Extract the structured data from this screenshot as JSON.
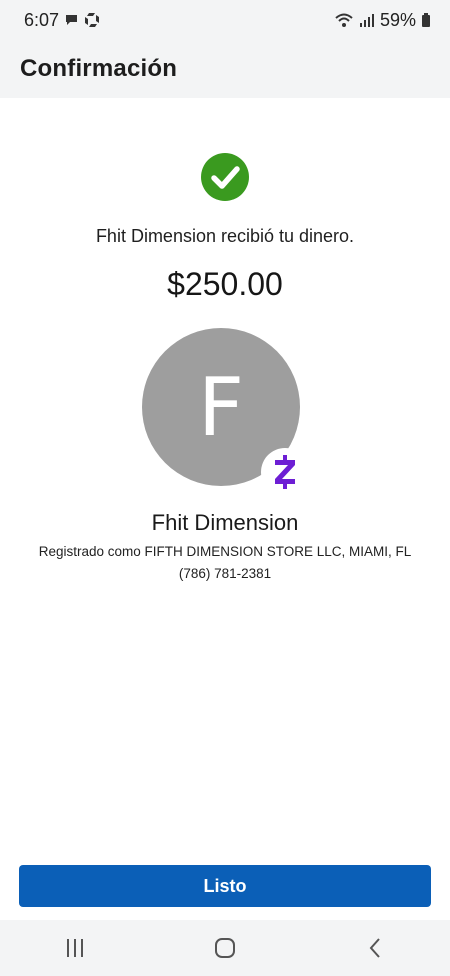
{
  "status_bar": {
    "time": "6:07",
    "battery": "59%"
  },
  "header": {
    "title": "Confirmación"
  },
  "confirmation": {
    "message": "Fhit Dimension recibió tu dinero.",
    "amount": "$250.00",
    "avatar_initial": "F",
    "recipient_name": "Fhit Dimension",
    "registered_as": "Registrado como FIFTH DIMENSION STORE LLC, MIAMI, FL",
    "phone": "(786) 781-2381"
  },
  "actions": {
    "done_label": "Listo"
  },
  "colors": {
    "success_green": "#3a9a1f",
    "primary_blue": "#0b5fb7",
    "zelle_purple": "#6d1ed4",
    "avatar_gray": "#9e9e9e"
  }
}
